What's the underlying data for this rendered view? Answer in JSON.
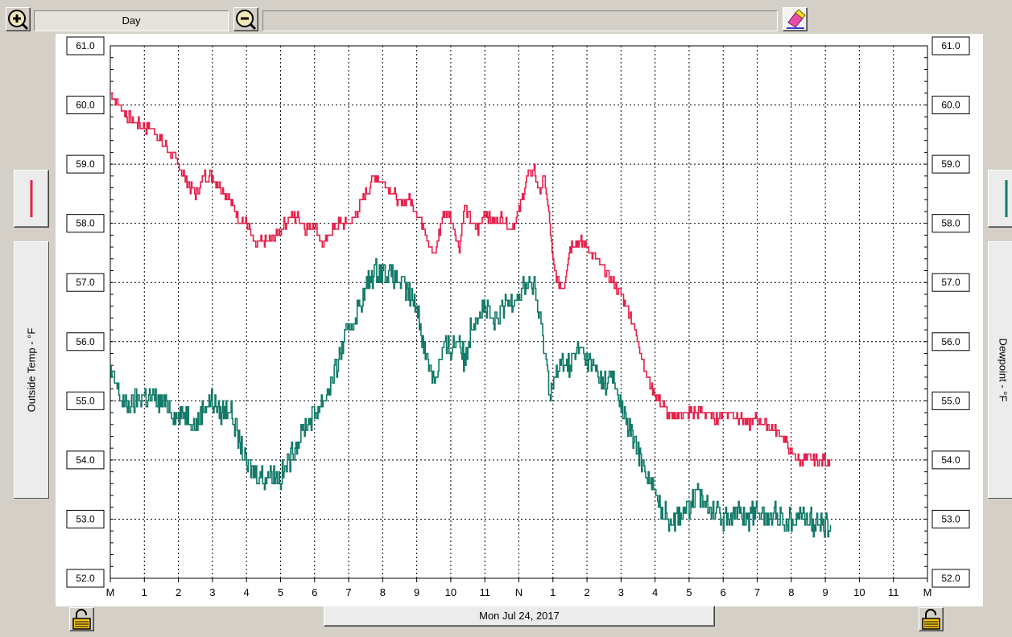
{
  "toolbar": {
    "zoom_in_icon": "zoom-in-icon",
    "range_label": "Day",
    "zoom_out_icon": "zoom-out-icon",
    "info_text": "",
    "marker_icon": "eraser-icon"
  },
  "left_panel": {
    "series_label": "Outside Temp - °F",
    "series_color": "#e8204a"
  },
  "right_panel": {
    "series_label": "Dewpoint - °F",
    "series_color": "#127a68"
  },
  "footer": {
    "date_label": "Mon Jul 24, 2017",
    "left_lock_icon": "unlocked-padlock-icon",
    "right_lock_icon": "unlocked-padlock-icon"
  },
  "chart_data": {
    "type": "line",
    "x_tick_labels": [
      "M",
      "1",
      "2",
      "3",
      "4",
      "5",
      "6",
      "7",
      "8",
      "9",
      "10",
      "11",
      "N",
      "1",
      "2",
      "3",
      "4",
      "5",
      "6",
      "7",
      "8",
      "9",
      "10",
      "11",
      "M"
    ],
    "x_range_hours": [
      0,
      24
    ],
    "ylim": [
      52.0,
      61.0
    ],
    "y_ticks": [
      "61.0",
      "60.0",
      "59.0",
      "58.0",
      "57.0",
      "56.0",
      "55.0",
      "54.0",
      "53.0",
      "52.0"
    ],
    "grid": true,
    "series": [
      {
        "name": "Outside Temp - °F",
        "color": "#e8204a",
        "x": [
          0,
          0.25,
          0.5,
          0.75,
          1.0,
          1.25,
          1.5,
          1.75,
          2.0,
          2.25,
          2.5,
          2.75,
          3.0,
          3.25,
          3.5,
          3.75,
          4.0,
          4.25,
          4.5,
          4.75,
          5.0,
          5.25,
          5.5,
          5.75,
          6.0,
          6.25,
          6.5,
          6.75,
          7.0,
          7.25,
          7.5,
          7.75,
          8.0,
          8.25,
          8.5,
          8.75,
          9.0,
          9.25,
          9.5,
          9.65,
          9.8,
          10.0,
          10.25,
          10.4,
          10.6,
          10.8,
          11.0,
          11.25,
          11.5,
          11.75,
          12.0,
          12.25,
          12.45,
          12.6,
          12.75,
          12.9,
          13.0,
          13.15,
          13.3,
          13.5,
          13.75,
          14.0,
          14.25,
          14.5,
          14.75,
          15.0,
          15.25,
          15.5,
          15.75,
          16.0,
          16.25,
          16.5,
          16.75,
          17.0,
          17.25,
          17.5,
          17.75,
          18.0,
          18.25,
          18.5,
          18.75,
          19.0,
          19.25,
          19.5,
          19.75,
          20.0,
          20.25,
          20.5,
          20.75,
          21.0,
          21.15
        ],
        "y": [
          60.2,
          60.0,
          59.8,
          59.7,
          59.6,
          59.6,
          59.4,
          59.2,
          59.0,
          58.7,
          58.5,
          58.8,
          58.8,
          58.6,
          58.4,
          58.1,
          58.0,
          57.6,
          57.7,
          57.7,
          57.9,
          58.1,
          58.1,
          57.9,
          58.0,
          57.6,
          57.9,
          58.0,
          58.0,
          58.2,
          58.5,
          58.8,
          58.7,
          58.6,
          58.3,
          58.4,
          58.2,
          57.9,
          57.4,
          57.8,
          58.2,
          58.1,
          57.6,
          58.3,
          58.0,
          57.9,
          58.2,
          58.0,
          58.1,
          57.9,
          58.2,
          58.8,
          58.9,
          58.5,
          58.8,
          58.0,
          57.3,
          57.0,
          56.9,
          57.6,
          57.7,
          57.6,
          57.4,
          57.2,
          57.0,
          56.8,
          56.5,
          56.0,
          55.4,
          55.1,
          54.9,
          54.7,
          54.8,
          54.8,
          54.8,
          54.8,
          54.7,
          54.8,
          54.8,
          54.7,
          54.6,
          54.7,
          54.6,
          54.5,
          54.4,
          54.1,
          54.0,
          54.0,
          54.0,
          54.0,
          54.0
        ]
      },
      {
        "name": "Dewpoint - °F",
        "color": "#127a68",
        "x": [
          0,
          0.25,
          0.5,
          0.75,
          1.0,
          1.25,
          1.5,
          1.75,
          2.0,
          2.25,
          2.5,
          2.75,
          3.0,
          3.25,
          3.5,
          3.75,
          4.0,
          4.25,
          4.5,
          4.75,
          5.0,
          5.25,
          5.5,
          5.75,
          6.0,
          6.25,
          6.5,
          6.75,
          7.0,
          7.25,
          7.5,
          7.75,
          8.0,
          8.25,
          8.5,
          8.75,
          9.0,
          9.25,
          9.5,
          9.65,
          9.8,
          10.0,
          10.25,
          10.4,
          10.6,
          10.8,
          11.0,
          11.25,
          11.5,
          11.75,
          12.0,
          12.25,
          12.45,
          12.6,
          12.75,
          12.9,
          13.0,
          13.15,
          13.3,
          13.5,
          13.75,
          14.0,
          14.25,
          14.5,
          14.75,
          15.0,
          15.25,
          15.5,
          15.75,
          16.0,
          16.25,
          16.5,
          16.75,
          17.0,
          17.25,
          17.5,
          17.75,
          18.0,
          18.25,
          18.5,
          18.75,
          19.0,
          19.25,
          19.5,
          19.75,
          20.0,
          20.25,
          20.5,
          20.75,
          21.0,
          21.15
        ],
        "y": [
          55.5,
          55.1,
          54.9,
          55.0,
          55.1,
          55.0,
          55.0,
          54.9,
          54.7,
          54.8,
          54.6,
          54.9,
          55.0,
          54.8,
          54.9,
          54.4,
          53.9,
          53.8,
          53.7,
          53.8,
          53.7,
          54.0,
          54.3,
          54.6,
          54.8,
          55.0,
          55.3,
          55.8,
          56.2,
          56.5,
          56.9,
          57.2,
          57.2,
          57.1,
          57.0,
          56.8,
          56.6,
          55.8,
          55.4,
          55.6,
          55.9,
          55.9,
          56.1,
          55.6,
          56.3,
          56.5,
          56.6,
          56.3,
          56.5,
          56.7,
          56.8,
          57.0,
          56.9,
          56.4,
          55.9,
          55.2,
          55.3,
          55.5,
          55.7,
          55.6,
          55.9,
          55.7,
          55.5,
          55.3,
          55.4,
          54.9,
          54.5,
          54.1,
          53.8,
          53.4,
          53.1,
          53.0,
          53.1,
          53.2,
          53.4,
          53.3,
          53.2,
          53.0,
          53.1,
          53.1,
          53.0,
          53.2,
          53.0,
          53.1,
          53.0,
          53.0,
          53.1,
          53.0,
          52.9,
          52.9,
          52.9
        ]
      }
    ]
  }
}
